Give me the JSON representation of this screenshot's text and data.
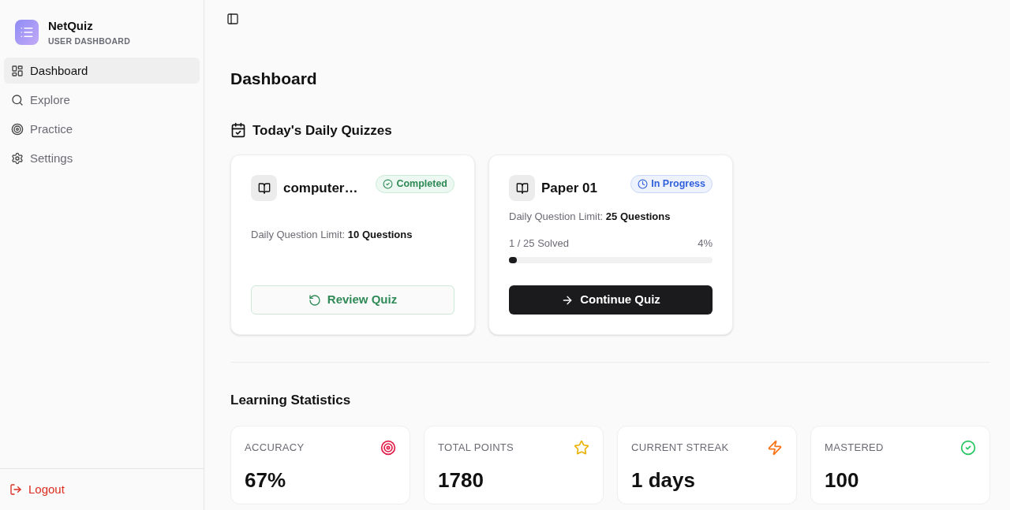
{
  "app": {
    "name": "NetQuiz",
    "subtitle": "USER DASHBOARD"
  },
  "nav": [
    {
      "label": "Dashboard",
      "kind": "dashboard",
      "selected": true
    },
    {
      "label": "Explore",
      "kind": "search",
      "selected": false
    },
    {
      "label": "Practice",
      "kind": "target",
      "selected": false
    },
    {
      "label": "Settings",
      "kind": "settings",
      "selected": false
    }
  ],
  "logout": "Logout",
  "page_title": "Dashboard",
  "daily_section": "Today's Daily Quizzes",
  "quizzes": [
    {
      "title": "computer…",
      "kind": "completed",
      "badge": "Completed",
      "limit_label": "Daily Question Limit:",
      "limit_value": "10 Questions",
      "button": "Review Quiz"
    },
    {
      "title": "Paper 01",
      "kind": "in_progress",
      "badge": "In Progress",
      "limit_label": "Daily Question Limit:",
      "limit_value": "25 Questions",
      "progress_label": "1 / 25 Solved",
      "progress_percent": "4%",
      "level": 0.04,
      "button": "Continue Quiz"
    }
  ],
  "stats_section": "Learning Statistics",
  "stats": [
    {
      "label": "ACCURACY",
      "value": "67%",
      "kind": "target",
      "color": "#e11d48"
    },
    {
      "label": "TOTAL POINTS",
      "value": "1780",
      "kind": "star",
      "color": "#eab308"
    },
    {
      "label": "CURRENT STREAK",
      "value": "1 days",
      "kind": "zap",
      "color": "#f97316"
    },
    {
      "label": "MASTERED",
      "value": "100",
      "kind": "check",
      "color": "#22c55e"
    }
  ]
}
